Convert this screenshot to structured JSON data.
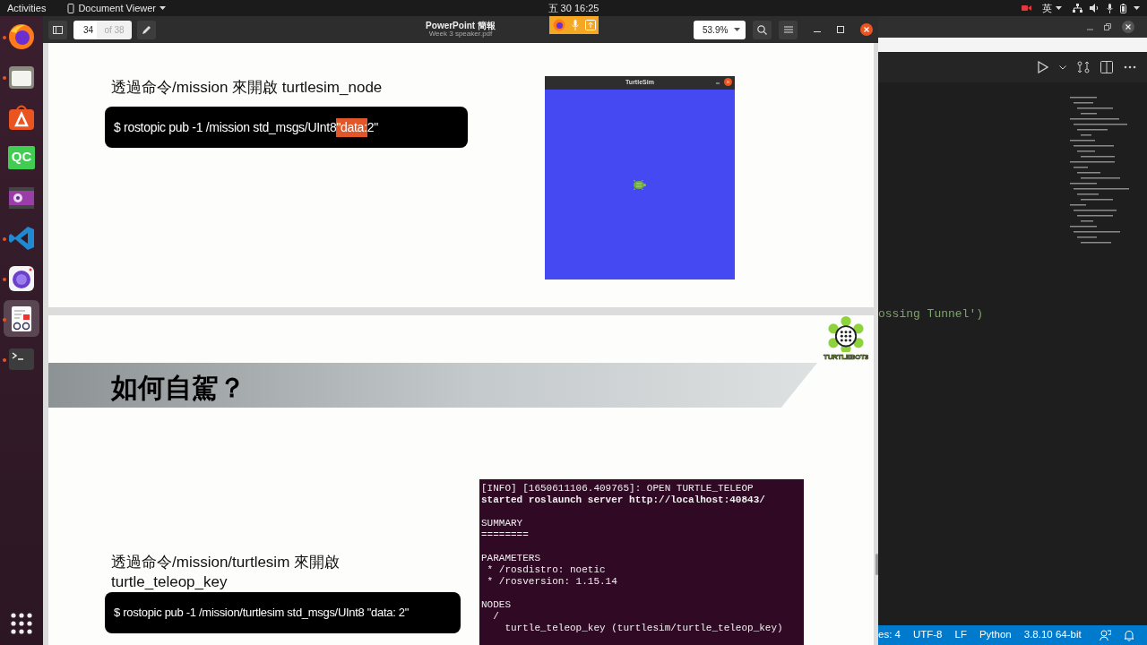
{
  "top_bar": {
    "activities": "Activities",
    "app_menu": "Document Viewer",
    "clock": "五 30 16:25",
    "input_method": "英"
  },
  "dock": {
    "items": [
      {
        "kind": "browser",
        "running": true,
        "selected": false
      },
      {
        "kind": "files",
        "running": true,
        "selected": false
      },
      {
        "kind": "software",
        "running": false,
        "selected": false
      },
      {
        "kind": "qc",
        "label": "QC",
        "running": false,
        "selected": false
      },
      {
        "kind": "video",
        "running": false,
        "selected": false
      },
      {
        "kind": "code",
        "running": true,
        "selected": false
      },
      {
        "kind": "camera",
        "running": true,
        "selected": false
      },
      {
        "kind": "document",
        "running": true,
        "selected": true
      },
      {
        "kind": "terminal",
        "running": true,
        "selected": false
      }
    ]
  },
  "viewer": {
    "page_number": "34",
    "page_total": "of 38",
    "title": "PowerPoint 簡報",
    "subtitle": "Week 3 speaker.pdf",
    "zoom": "53.9%"
  },
  "slides": [
    {
      "caption": "透過命令/mission 來開啟 turtlesim_node",
      "command": [
        {
          "text": "$ rostopic pub -1 /mission std_msgs/UInt8 ",
          "highlighted": false
        },
        {
          "text": "\"data:",
          "highlighted": true
        },
        {
          "text": " 2\"",
          "highlighted": false
        }
      ],
      "turtlesim": {
        "title": "TurtleSim"
      }
    },
    {
      "logo_text": "TURTLEBOT3",
      "heading": "如何自駕？",
      "caption_lines": [
        "透過命令/mission/turtlesim 來開啟",
        "turtle_teleop_key"
      ],
      "command": [
        {
          "text": "$ rostopic pub -1 /mission/turtlesim std_msgs/UInt8 \"data: 2\"",
          "highlighted": false
        }
      ],
      "terminal_blocks": [
        {
          "lines": [
            {
              "text": "[INFO] [1650611106.409765]: OPEN TURTLE_TELEOP",
              "bold": false
            },
            {
              "text": "started roslaunch server http://localhost:40843/",
              "bold": true
            }
          ]
        },
        {
          "lines": [
            {
              "text": "SUMMARY",
              "bold": false
            },
            {
              "text": "========",
              "bold": false
            }
          ]
        },
        {
          "lines": [
            {
              "text": "PARAMETERS",
              "bold": false
            },
            {
              "text": " * /rosdistro: noetic",
              "bold": false
            },
            {
              "text": " * /rosversion: 1.15.14",
              "bold": false
            }
          ]
        },
        {
          "lines": [
            {
              "text": "NODES",
              "bold": false
            },
            {
              "text": "  /",
              "bold": false
            },
            {
              "text": "    turtle_teleop_key (turtlesim/turtle_teleop_key)",
              "bold": false
            }
          ]
        }
      ]
    }
  ],
  "editor": {
    "code_line": "ossing Tunnel')",
    "status_items": [
      "es: 4",
      "UTF-8",
      "LF",
      "Python",
      "3.8.10 64-bit"
    ]
  }
}
